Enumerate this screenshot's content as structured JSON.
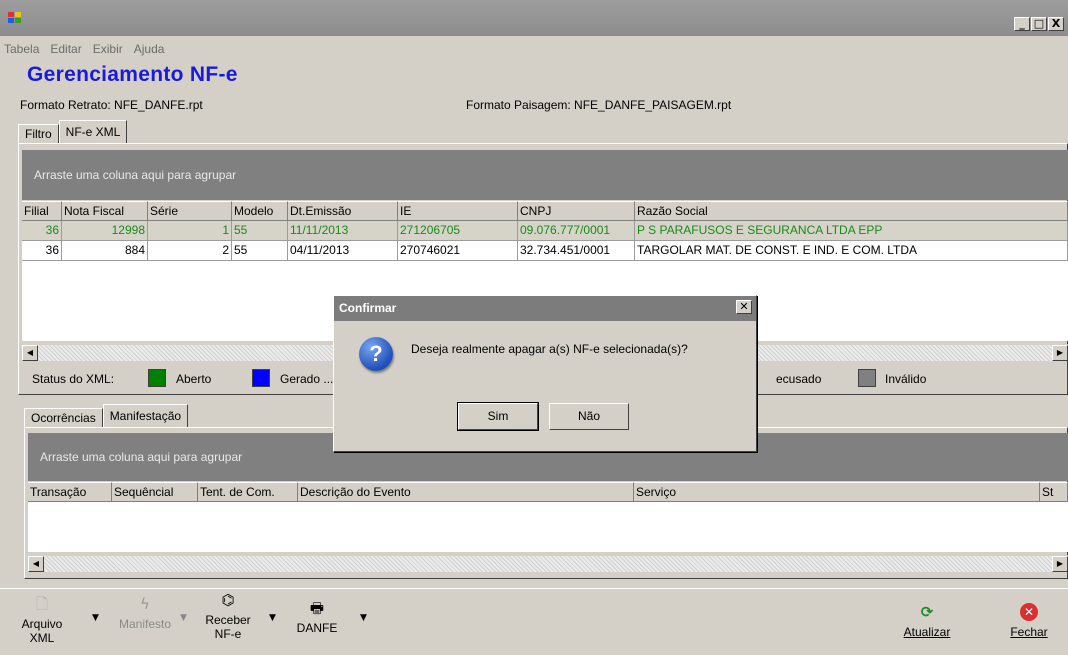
{
  "window": {
    "minimize": "_",
    "maximize": "□",
    "close": "X"
  },
  "menu": [
    "Tabela",
    "Editar",
    "Exibir",
    "Ajuda"
  ],
  "title": "Gerenciamento NF-e",
  "formats": {
    "retrato": "Formato Retrato: NFE_DANFE.rpt",
    "paisagem": "Formato Paisagem: NFE_DANFE_PAISAGEM.rpt"
  },
  "top_tabs": [
    "Filtro",
    "NF-e XML"
  ],
  "group_hint": "Arraste uma coluna aqui para agrupar",
  "nfe_grid": {
    "columns": [
      "Filial",
      "Nota Fiscal",
      "Série",
      "Modelo",
      "Dt.Emissão",
      "IE",
      "CNPJ",
      "Razão Social"
    ],
    "rows": [
      [
        "36",
        "12998",
        "1",
        "55",
        "11/11/2013",
        "271206705",
        "09.076.777/0001",
        "P S PARAFUSOS E SEGURANCA LTDA EPP"
      ],
      [
        "36",
        "884",
        "2",
        "55",
        "04/11/2013",
        "270746021",
        "32.734.451/0001",
        "TARGOLAR MAT. DE CONST. E IND. E COM. LTDA"
      ]
    ]
  },
  "status_legend": {
    "label": "Status do XML:",
    "items": [
      {
        "label": "Aberto",
        "color": "#008000"
      },
      {
        "label": "Gerado ...",
        "color": "#0000ff"
      },
      {
        "label": "ecusado",
        "color": "#d4d0c8"
      },
      {
        "label": "Inválido",
        "color": "#808080"
      }
    ]
  },
  "bottom_tabs": [
    "Ocorrências",
    "Manifestação"
  ],
  "events_grid": {
    "columns": [
      "Transação",
      "Sequêncial",
      "Tent. de Com.",
      "Descrição do Evento",
      "Serviço",
      "St"
    ]
  },
  "toolbar": {
    "arquivo": "Arquivo XML",
    "manifesto": "Manifesto",
    "receber": "Receber NF-e",
    "danfe": "DANFE",
    "atualizar": "Atualizar",
    "fechar": "Fechar"
  },
  "dialog": {
    "title": "Confirmar",
    "message": "Deseja realmente apagar a(s) NF-e selecionada(s)?",
    "yes": "Sim",
    "no": "Não"
  },
  "colors": {
    "title_blue": "#1a1adb",
    "selected_text": "#1a8a1a",
    "group_bar": "#808080"
  }
}
